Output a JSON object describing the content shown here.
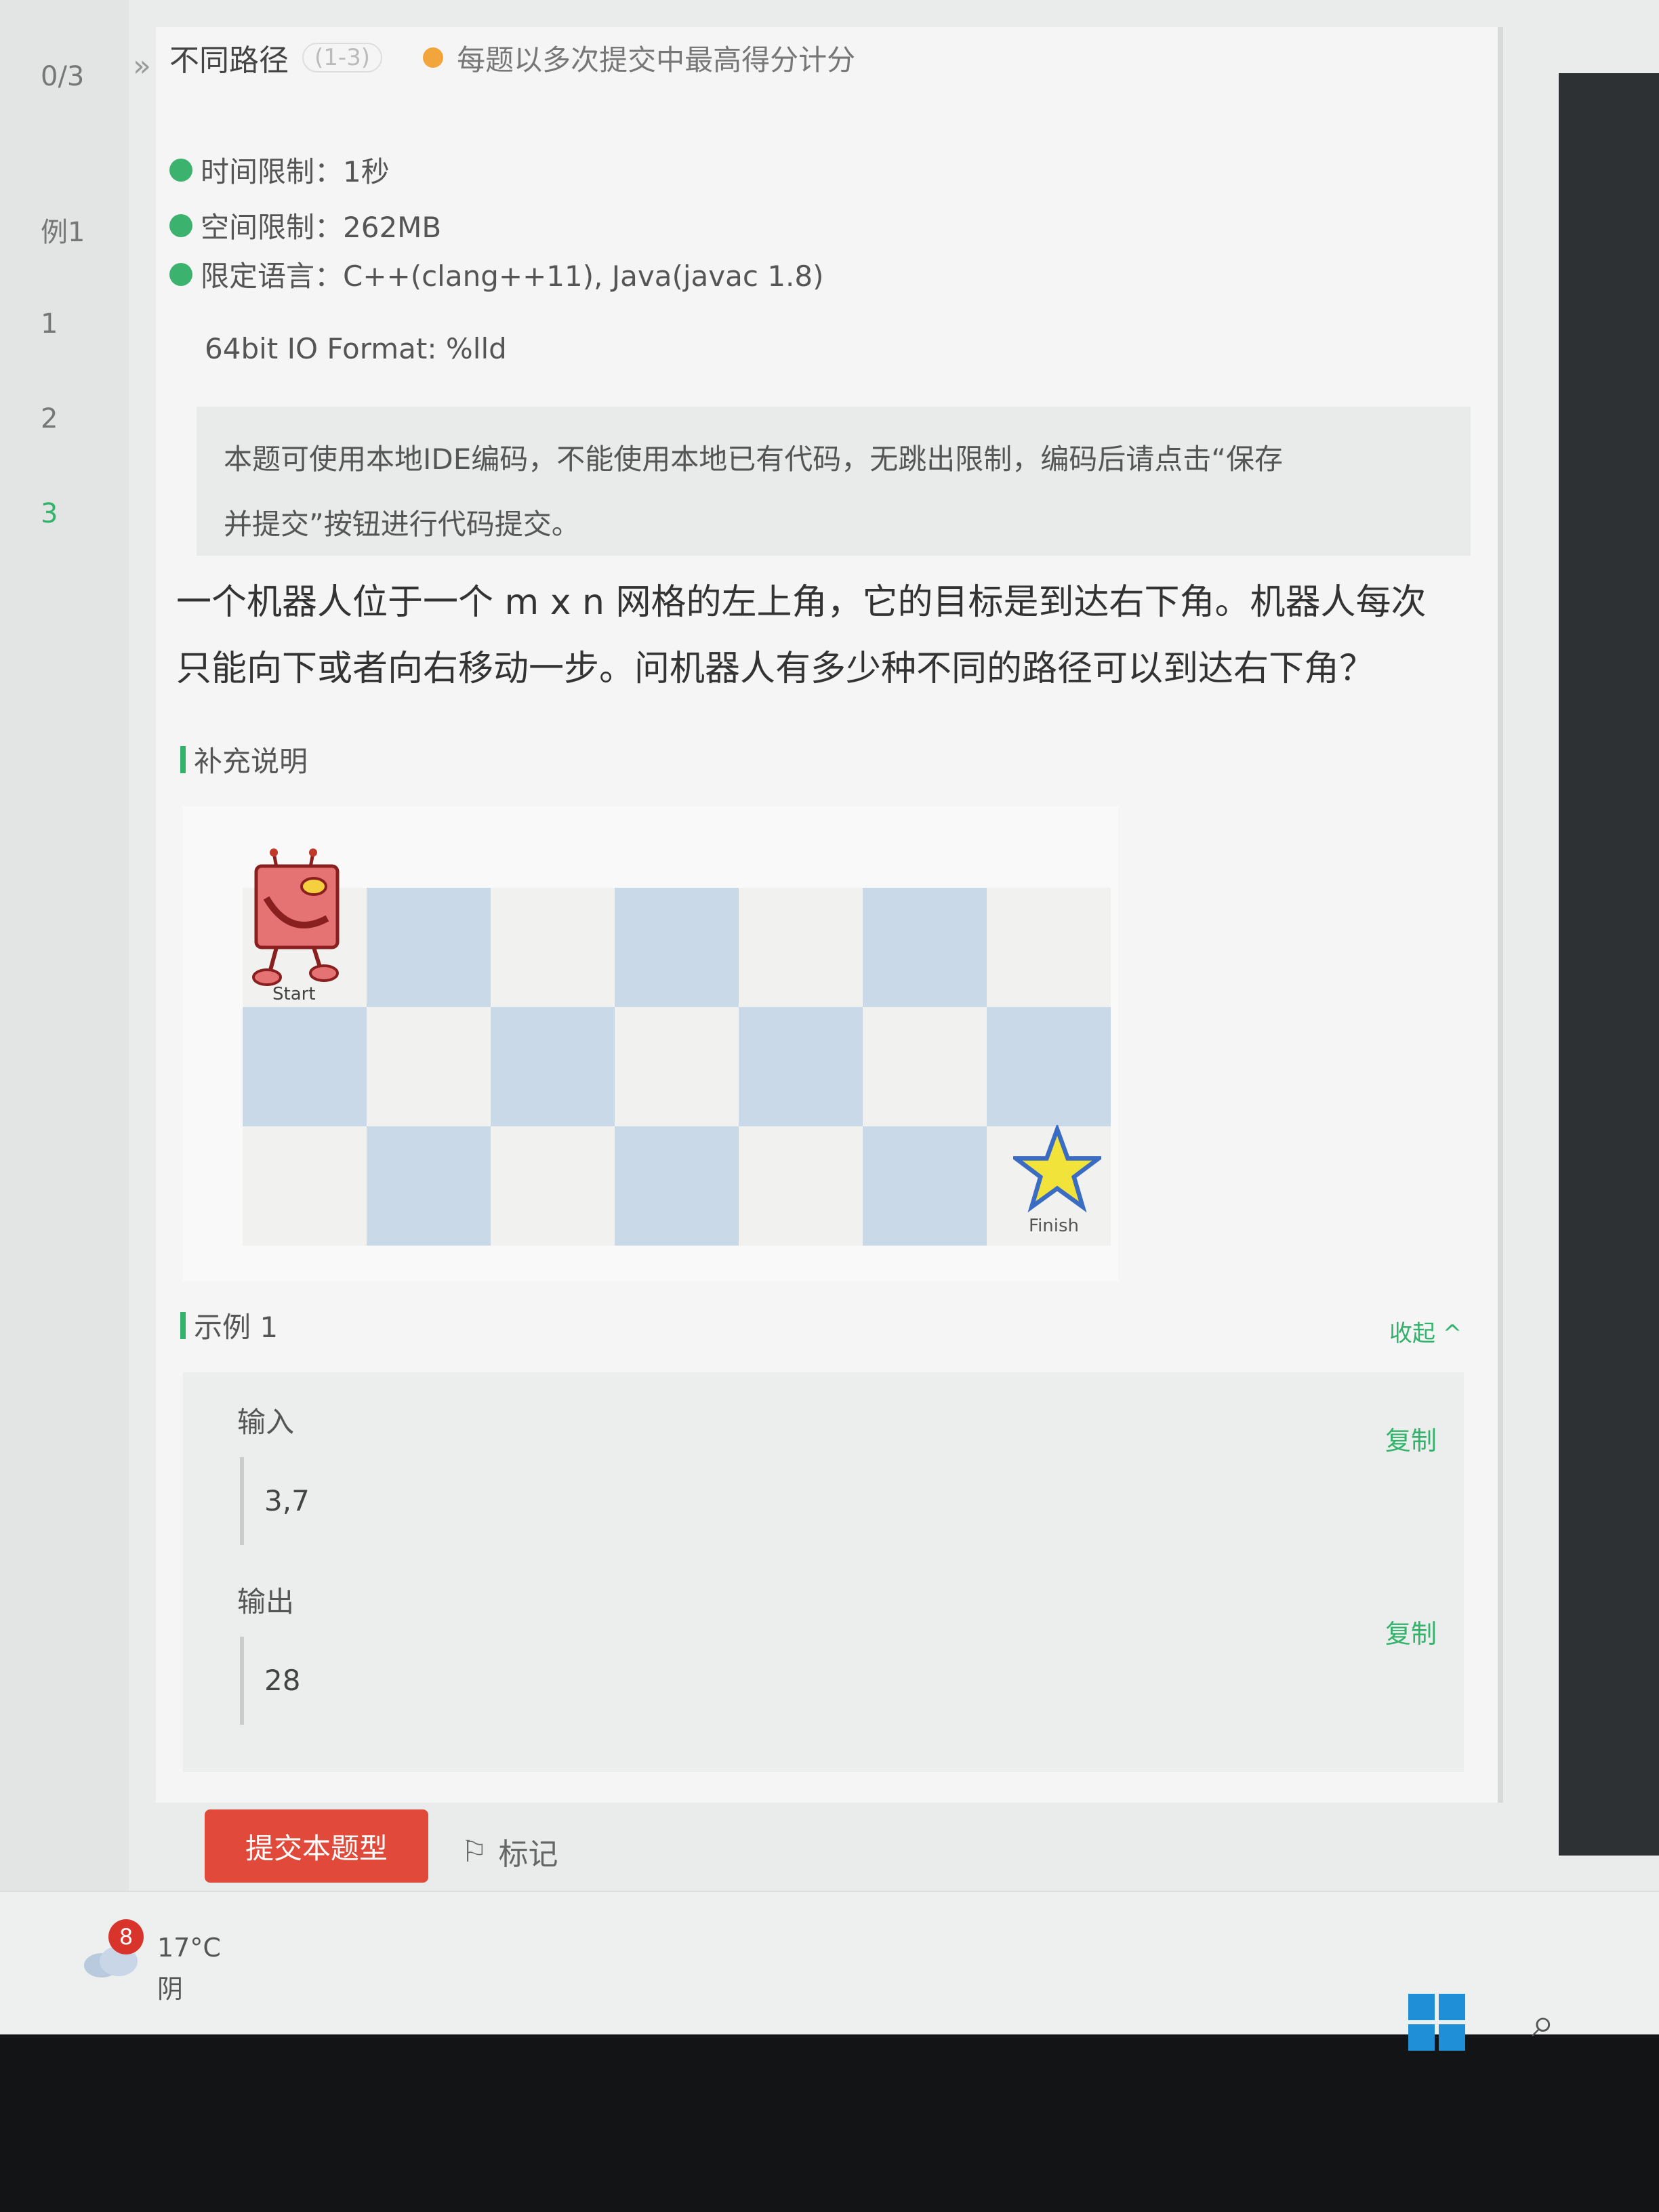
{
  "gutter": {
    "items": [
      "0/3",
      "例1",
      "1",
      "2",
      "3"
    ]
  },
  "header": {
    "collapse_glyph": "»",
    "title": "不同路径",
    "difficulty": "(1-3)",
    "score_note": "每题以多次提交中最高得分计分"
  },
  "limits": {
    "time": "时间限制：1秒",
    "memory": "空间限制：262MB",
    "language": "限定语言：C++(clang++11), Java(javac 1.8)",
    "io_format": "64bit IO Format: %lld"
  },
  "notice": {
    "line1": "本题可使用本地IDE编码，不能使用本地已有代码，无跳出限制，编码后请点击“保存",
    "line2": "并提交”按钮进行代码提交。"
  },
  "description": {
    "line1": "一个机器人位于一个 m x n 网格的左上角，它的目标是到达右下角。机器人每次",
    "line2": "只能向下或者向右移动一步。问机器人有多少种不同的路径可以到达右下角？"
  },
  "supplement": {
    "heading": "补充说明"
  },
  "figure": {
    "start_label": "Start",
    "finish_label": "Finish"
  },
  "example": {
    "heading": "示例 1",
    "collapse_label": "收起 ^",
    "input_label": "输入",
    "input_value": "3,7",
    "output_label": "输出",
    "output_value": "28",
    "copy_label": "复制"
  },
  "actions": {
    "submit_label": "提交本题型",
    "flag_label": "标记",
    "flag_glyph": "⚐"
  },
  "taskbar": {
    "badge": "8",
    "temperature": "17°C",
    "condition": "阴",
    "search_glyph": "⌕"
  }
}
